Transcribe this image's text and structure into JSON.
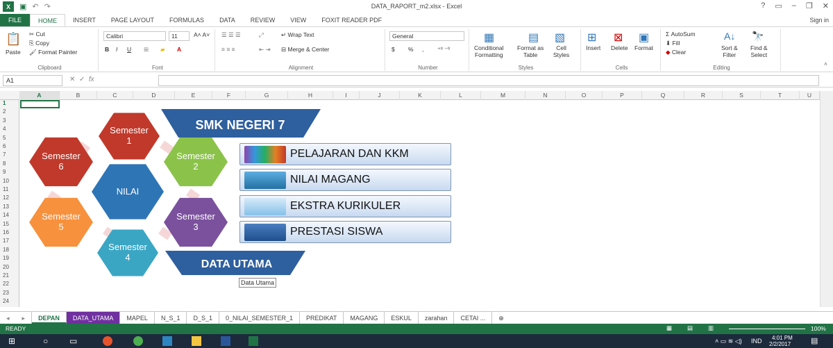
{
  "window": {
    "title": "DATA_RAPORT_m2.xlsx - Excel",
    "help": "?",
    "signin": "Sign in"
  },
  "ribbon_tabs": [
    "FILE",
    "HOME",
    "INSERT",
    "PAGE LAYOUT",
    "FORMULAS",
    "DATA",
    "REVIEW",
    "VIEW",
    "FOXIT READER PDF"
  ],
  "clipboard": {
    "paste": "Paste",
    "cut": "Cut",
    "copy": "Copy",
    "format_painter": "Format Painter",
    "label": "Clipboard"
  },
  "font": {
    "name": "Calibri",
    "size": "11",
    "label": "Font",
    "bold": "B",
    "italic": "I",
    "underline": "U"
  },
  "alignment": {
    "wrap": "Wrap Text",
    "merge": "Merge & Center",
    "label": "Alignment"
  },
  "number": {
    "format": "General",
    "currency": "$",
    "percent": "%",
    "comma": ",",
    "label": "Number"
  },
  "styles": {
    "conditional": "Conditional",
    "formatting": "Formatting",
    "format_as": "Format as",
    "table": "Table",
    "cell": "Cell",
    "cell_styles": "Styles",
    "label": "Styles"
  },
  "cells": {
    "insert": "Insert",
    "delete": "Delete",
    "format": "Format",
    "label": "Cells"
  },
  "editing": {
    "autosum": "AutoSum",
    "fill": "Fill",
    "clear": "Clear",
    "sort": "Sort &",
    "filter": "Filter",
    "find": "Find &",
    "select": "Select",
    "label": "Editing"
  },
  "formula_bar": {
    "cell_ref": "A1",
    "fx": "fx",
    "value": ""
  },
  "columns": [
    "A",
    "B",
    "C",
    "D",
    "E",
    "F",
    "G",
    "H",
    "I",
    "J",
    "K",
    "L",
    "M",
    "N",
    "O",
    "P",
    "Q",
    "R",
    "S",
    "T",
    "U"
  ],
  "rows": [
    "1",
    "2",
    "3",
    "4",
    "5",
    "6",
    "7",
    "8",
    "9",
    "10",
    "11",
    "12",
    "13",
    "14",
    "15",
    "16",
    "17",
    "18",
    "19",
    "20",
    "21",
    "22",
    "23",
    "24"
  ],
  "infographic": {
    "school": "SMK NEGERI 7",
    "center": "NILAI",
    "sem1": [
      "Semester",
      "1"
    ],
    "sem2": [
      "Semester",
      "2"
    ],
    "sem3": [
      "Semester",
      "3"
    ],
    "sem4": [
      "Semester",
      "4"
    ],
    "sem5": [
      "Semester",
      "5"
    ],
    "sem6": [
      "Semester",
      "6"
    ],
    "main_data": "DATA UTAMA",
    "tooltip": "Data Utama",
    "colors": {
      "red": "#c0392b",
      "green": "#8bc34a",
      "purple": "#7b519d",
      "teal": "#3aa6c4",
      "orange": "#f7913d",
      "blue": "#2e75b6",
      "banner": "#2e5f9e"
    }
  },
  "menu": [
    {
      "label": "PELAJARAN DAN KKM",
      "icon": "books-icon"
    },
    {
      "label": "NILAI MAGANG",
      "icon": "cursor-card-icon"
    },
    {
      "label": "EKSTRA KURIKULER",
      "icon": "book-icon"
    },
    {
      "label": "PRESTASI SISWA",
      "icon": "trophy-icon"
    }
  ],
  "sheets": [
    "DEPAN",
    "DATA_UTAMA",
    "MAPEL",
    "N_S_1",
    "D_S_1",
    "0_NILAI_SEMESTER_1",
    "PREDIKAT",
    "MAGANG",
    "ESKUL",
    "zarahan",
    "CETAI ..."
  ],
  "status": {
    "ready": "READY",
    "zoom": "100%"
  },
  "tray": {
    "time": "4:01 PM",
    "date": "2/2/2017",
    "lang": "IND"
  }
}
